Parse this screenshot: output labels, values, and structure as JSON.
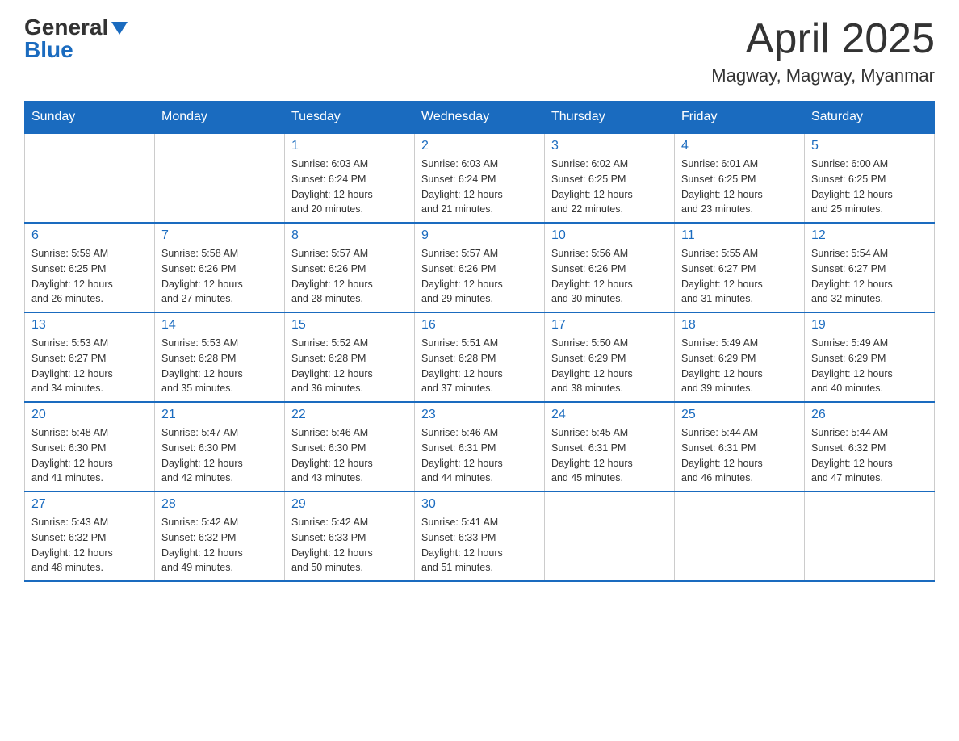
{
  "header": {
    "logo_general": "General",
    "logo_blue": "Blue",
    "title": "April 2025",
    "subtitle": "Magway, Magway, Myanmar"
  },
  "days_of_week": [
    "Sunday",
    "Monday",
    "Tuesday",
    "Wednesday",
    "Thursday",
    "Friday",
    "Saturday"
  ],
  "weeks": [
    [
      {
        "day": "",
        "info": ""
      },
      {
        "day": "",
        "info": ""
      },
      {
        "day": "1",
        "info": "Sunrise: 6:03 AM\nSunset: 6:24 PM\nDaylight: 12 hours\nand 20 minutes."
      },
      {
        "day": "2",
        "info": "Sunrise: 6:03 AM\nSunset: 6:24 PM\nDaylight: 12 hours\nand 21 minutes."
      },
      {
        "day": "3",
        "info": "Sunrise: 6:02 AM\nSunset: 6:25 PM\nDaylight: 12 hours\nand 22 minutes."
      },
      {
        "day": "4",
        "info": "Sunrise: 6:01 AM\nSunset: 6:25 PM\nDaylight: 12 hours\nand 23 minutes."
      },
      {
        "day": "5",
        "info": "Sunrise: 6:00 AM\nSunset: 6:25 PM\nDaylight: 12 hours\nand 25 minutes."
      }
    ],
    [
      {
        "day": "6",
        "info": "Sunrise: 5:59 AM\nSunset: 6:25 PM\nDaylight: 12 hours\nand 26 minutes."
      },
      {
        "day": "7",
        "info": "Sunrise: 5:58 AM\nSunset: 6:26 PM\nDaylight: 12 hours\nand 27 minutes."
      },
      {
        "day": "8",
        "info": "Sunrise: 5:57 AM\nSunset: 6:26 PM\nDaylight: 12 hours\nand 28 minutes."
      },
      {
        "day": "9",
        "info": "Sunrise: 5:57 AM\nSunset: 6:26 PM\nDaylight: 12 hours\nand 29 minutes."
      },
      {
        "day": "10",
        "info": "Sunrise: 5:56 AM\nSunset: 6:26 PM\nDaylight: 12 hours\nand 30 minutes."
      },
      {
        "day": "11",
        "info": "Sunrise: 5:55 AM\nSunset: 6:27 PM\nDaylight: 12 hours\nand 31 minutes."
      },
      {
        "day": "12",
        "info": "Sunrise: 5:54 AM\nSunset: 6:27 PM\nDaylight: 12 hours\nand 32 minutes."
      }
    ],
    [
      {
        "day": "13",
        "info": "Sunrise: 5:53 AM\nSunset: 6:27 PM\nDaylight: 12 hours\nand 34 minutes."
      },
      {
        "day": "14",
        "info": "Sunrise: 5:53 AM\nSunset: 6:28 PM\nDaylight: 12 hours\nand 35 minutes."
      },
      {
        "day": "15",
        "info": "Sunrise: 5:52 AM\nSunset: 6:28 PM\nDaylight: 12 hours\nand 36 minutes."
      },
      {
        "day": "16",
        "info": "Sunrise: 5:51 AM\nSunset: 6:28 PM\nDaylight: 12 hours\nand 37 minutes."
      },
      {
        "day": "17",
        "info": "Sunrise: 5:50 AM\nSunset: 6:29 PM\nDaylight: 12 hours\nand 38 minutes."
      },
      {
        "day": "18",
        "info": "Sunrise: 5:49 AM\nSunset: 6:29 PM\nDaylight: 12 hours\nand 39 minutes."
      },
      {
        "day": "19",
        "info": "Sunrise: 5:49 AM\nSunset: 6:29 PM\nDaylight: 12 hours\nand 40 minutes."
      }
    ],
    [
      {
        "day": "20",
        "info": "Sunrise: 5:48 AM\nSunset: 6:30 PM\nDaylight: 12 hours\nand 41 minutes."
      },
      {
        "day": "21",
        "info": "Sunrise: 5:47 AM\nSunset: 6:30 PM\nDaylight: 12 hours\nand 42 minutes."
      },
      {
        "day": "22",
        "info": "Sunrise: 5:46 AM\nSunset: 6:30 PM\nDaylight: 12 hours\nand 43 minutes."
      },
      {
        "day": "23",
        "info": "Sunrise: 5:46 AM\nSunset: 6:31 PM\nDaylight: 12 hours\nand 44 minutes."
      },
      {
        "day": "24",
        "info": "Sunrise: 5:45 AM\nSunset: 6:31 PM\nDaylight: 12 hours\nand 45 minutes."
      },
      {
        "day": "25",
        "info": "Sunrise: 5:44 AM\nSunset: 6:31 PM\nDaylight: 12 hours\nand 46 minutes."
      },
      {
        "day": "26",
        "info": "Sunrise: 5:44 AM\nSunset: 6:32 PM\nDaylight: 12 hours\nand 47 minutes."
      }
    ],
    [
      {
        "day": "27",
        "info": "Sunrise: 5:43 AM\nSunset: 6:32 PM\nDaylight: 12 hours\nand 48 minutes."
      },
      {
        "day": "28",
        "info": "Sunrise: 5:42 AM\nSunset: 6:32 PM\nDaylight: 12 hours\nand 49 minutes."
      },
      {
        "day": "29",
        "info": "Sunrise: 5:42 AM\nSunset: 6:33 PM\nDaylight: 12 hours\nand 50 minutes."
      },
      {
        "day": "30",
        "info": "Sunrise: 5:41 AM\nSunset: 6:33 PM\nDaylight: 12 hours\nand 51 minutes."
      },
      {
        "day": "",
        "info": ""
      },
      {
        "day": "",
        "info": ""
      },
      {
        "day": "",
        "info": ""
      }
    ]
  ]
}
